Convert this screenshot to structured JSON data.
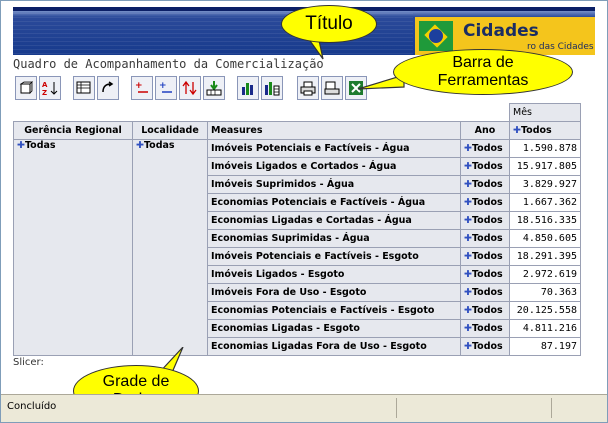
{
  "header": {
    "brand_title": "Cidades",
    "brand_subtitle": "ro das Cidades"
  },
  "page_title": "Quadro de Acompanhamento da Comercialização",
  "toolbar": {
    "buttons": [
      "layout-icon",
      "sort-icon",
      "drill-icon",
      "swap-icon",
      "expand-icon",
      "collapse-icon",
      "drill-updown-icon",
      "drill-through-icon",
      "chart-icon",
      "chart-grid-icon",
      "print-icon",
      "print-preview-icon",
      "excel-icon"
    ]
  },
  "grid": {
    "col_header_top": "Mês",
    "col_header_mes_value": "Todos",
    "headers": {
      "gerencia": "Gerência Regional",
      "localidade": "Localidade",
      "measures": "Measures",
      "ano": "Ano"
    },
    "gerencia_value": "Todas",
    "localidade_value": "Todas",
    "rows": [
      {
        "measure": "Imóveis Potenciais e Factíveis - Água",
        "ano": "Todos",
        "value": "1.590.878"
      },
      {
        "measure": "Imóveis Ligados e Cortados - Água",
        "ano": "Todos",
        "value": "15.917.805"
      },
      {
        "measure": "Imóveis Suprimidos - Água",
        "ano": "Todos",
        "value": "3.829.927"
      },
      {
        "measure": "Economias Potenciais e Factíveis - Água",
        "ano": "Todos",
        "value": "1.667.362"
      },
      {
        "measure": "Economias Ligadas e Cortadas - Água",
        "ano": "Todos",
        "value": "18.516.335"
      },
      {
        "measure": "Economias Suprimidas - Água",
        "ano": "Todos",
        "value": "4.850.605"
      },
      {
        "measure": "Imóveis Potenciais e Factíveis - Esgoto",
        "ano": "Todos",
        "value": "18.291.395"
      },
      {
        "measure": "Imóveis Ligados - Esgoto",
        "ano": "Todos",
        "value": "2.972.619"
      },
      {
        "measure": "Imóveis Fora de Uso - Esgoto",
        "ano": "Todos",
        "value": "70.363"
      },
      {
        "measure": "Economias Potenciais e Factíveis - Esgoto",
        "ano": "Todos",
        "value": "20.125.558"
      },
      {
        "measure": "Economias Ligadas - Esgoto",
        "ano": "Todos",
        "value": "4.811.216"
      },
      {
        "measure": "Economias Ligadas Fora de Uso - Esgoto",
        "ano": "Todos",
        "value": "87.197"
      }
    ]
  },
  "slicer_label": "Slicer:",
  "status_text": "Concluído",
  "callouts": {
    "titulo": "Título",
    "barra": "Barra de Ferramentas",
    "grade": "Grade de Dados"
  },
  "colors": {
    "callout_fill": "#ffff00",
    "banner_blue": "#173a8c",
    "brand_yellow": "#f4c51c",
    "grid_header_bg": "#e6e8ee",
    "expand_plus": "#3050c0"
  }
}
